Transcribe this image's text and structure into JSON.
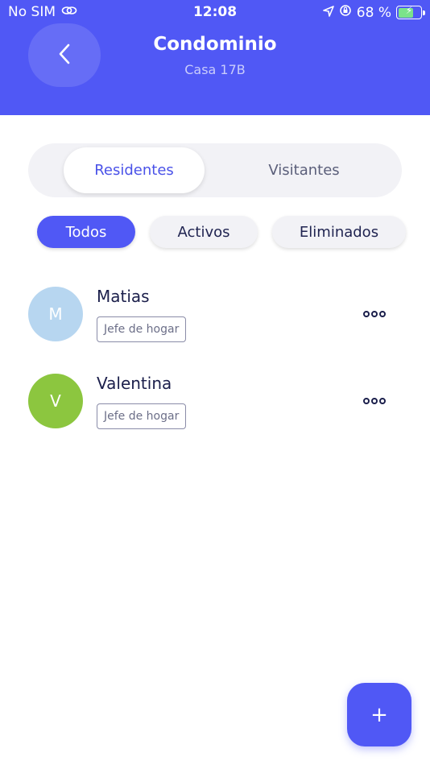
{
  "status_bar": {
    "carrier": "No SIM",
    "time": "12:08",
    "battery_percent": "68 %",
    "battery_level": 0.68
  },
  "header": {
    "title": "Condominio",
    "subtitle": "Casa 17B",
    "back_icon": "chevron-left-icon"
  },
  "tabs": [
    {
      "label": "Residentes",
      "active": true
    },
    {
      "label": "Visitantes",
      "active": false
    }
  ],
  "filters": [
    {
      "label": "Todos",
      "active": true
    },
    {
      "label": "Activos",
      "active": false
    },
    {
      "label": "Eliminados",
      "active": false
    }
  ],
  "residents": [
    {
      "initial": "M",
      "name": "Matias",
      "role": "Jefe de hogar",
      "avatar_color": "#b7d6f0"
    },
    {
      "initial": "V",
      "name": "Valentina",
      "role": "Jefe de hogar",
      "avatar_color": "#8cc63f"
    }
  ],
  "fab": {
    "label": "+"
  },
  "colors": {
    "primary": "#5058f5",
    "text_dark": "#1b1f4b"
  }
}
